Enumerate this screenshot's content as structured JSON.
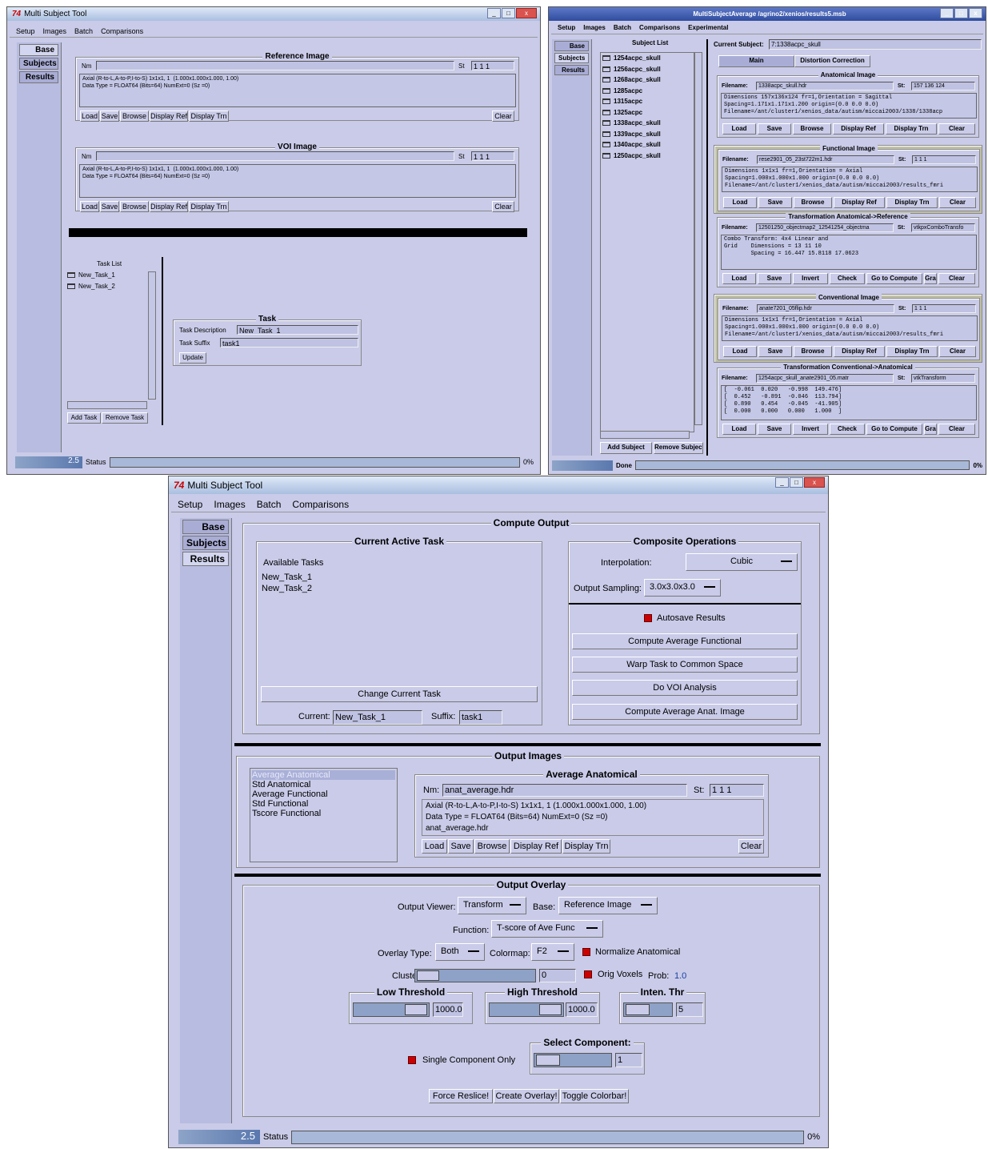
{
  "w1": {
    "title": "Multi Subject Tool",
    "menu": [
      "Setup",
      "Images",
      "Batch",
      "Comparisons"
    ],
    "tabs": [
      "Base",
      "Subjects",
      "Results"
    ],
    "ref": {
      "legend": "Reference Image",
      "nm_label": "Nm",
      "st_label": "St",
      "st_value": "1 1 1",
      "info1": "Axial (R-to-L,A-to-P,I-to-S) 1x1x1, 1  (1.000x1.000x1.000, 1.00)",
      "info2": "Data Type = FLOAT64 (Bits=64) NumExt=0 (Sz =0)"
    },
    "voi": {
      "legend": "VOI Image",
      "nm_label": "Nm",
      "st_label": "St",
      "st_value": "1 1 1",
      "info1": "Axial (R-to-L,A-to-P,I-to-S) 1x1x1, 1  (1.000x1.000x1.000, 1.00)",
      "info2": "Data Type = FLOAT64 (Bits=64) NumExt=0 (Sz =0)"
    },
    "imgbtns": [
      "Load",
      "Save",
      "Browse",
      "Display Ref",
      "Display Trn"
    ],
    "clear": "Clear",
    "tasklist": {
      "title": "Task List",
      "items": [
        "New_Task_1",
        "New_Task_2"
      ],
      "add": "Add Task",
      "remove": "Remove Task"
    },
    "task": {
      "legend": "Task",
      "desc_label": "Task Description",
      "desc": "New_Task_1",
      "suffix_label": "Task Suffix",
      "suffix": "task1",
      "update": "Update"
    },
    "status": {
      "zoom": "2.5",
      "label": "Status",
      "pct": "0%"
    }
  },
  "w2": {
    "title": "MultiSubjectAverage /agrino2/xenios/results5.msb",
    "menu": [
      "Setup",
      "Images",
      "Batch",
      "Comparisons",
      "Experimental"
    ],
    "tabs": [
      "Base",
      "Subjects",
      "Results"
    ],
    "subject_list": {
      "title": "Subject List",
      "items": [
        "1254acpc_skull",
        "1256acpc_skull",
        "1268acpc_skull",
        "1285acpc",
        "1315acpc",
        "1325acpc",
        "1338acpc_skull",
        "1339acpc_skull",
        "1340acpc_skull",
        "1250acpc_skull"
      ],
      "add": "Add Subject",
      "remove": "Remove Subject"
    },
    "current_label": "Current Subject:",
    "current_value": "7:1338acpc_skull",
    "subtabs": [
      "Main",
      "Distortion Correction"
    ],
    "anat": {
      "legend": "Anatomical Image",
      "fn_label": "Filename:",
      "fn": "1338acpc_skull.hdr",
      "st_label": "St:",
      "st": "157 136 124",
      "info": "Dimensions 157x136x124 fr=1,Orientation = Sagittal\nSpacing=1.171x1.171x1.200 origin=(0.0 0.0 0.0)\nFilename=/ant/cluster1/xenios_data/autism/miccai2003/1338/1338acp"
    },
    "func": {
      "legend": "Functional Image",
      "fn_label": "Filename:",
      "fn": "rese2901_05_23st722m1.hdr",
      "st_label": "St:",
      "st": "1 1 1",
      "info": "Dimensions 1x1x1 fr=1,Orientation = Axial\nSpacing=1.000x1.000x1.000 origin=(0.0 0.0 0.0)\nFilename=/ant/cluster1/xenios_data/autism/miccai2003/results_fmri"
    },
    "tar": {
      "legend": "Transformation Anatomical->Reference",
      "fn_label": "Filename:",
      "fn": "12501250_objectmap2_12541254_objectma",
      "st_label": "St:",
      "st": "vtkpxComboTransfo",
      "info": "Combo Transform: 4x4 Linear and\nGrid    Dimensions = 13 11 10\n        Spacing = 16.447 15.8118 17.0623"
    },
    "conv": {
      "legend": "Conventional Image",
      "fn_label": "Filename:",
      "fn": "anate7201_05flip.hdr",
      "st_label": "St:",
      "st": "1 1 1",
      "info": "Dimensions 1x1x1 fr=1,Orientation = Axial\nSpacing=1.000x1.000x1.000 origin=(0.0 0.0 0.0)\nFilename=/ant/cluster1/xenios_data/autism/miccai2003/results_fmri"
    },
    "tca": {
      "legend": "Transformation Conventional->Anatomical",
      "fn_label": "Filename:",
      "fn": "1254acpc_skull_anate2901_05.matr",
      "st_label": "St:",
      "st": "vtkTransform",
      "info": "[  -0.061  0.020   -0.998  149.476]\n[  0.452   -0.891  -0.046  113.794]\n[  0.890   0.454   -0.045  -41.905]\n[  0.000   0.000   0.000   1.000  ]"
    },
    "btns_img": [
      "Load",
      "Save",
      "Browse",
      "Display Ref",
      "Display Trn",
      "Clear"
    ],
    "btns_xf": [
      "Load",
      "Save",
      "Invert",
      "Check",
      "Go to Compute",
      "Gra",
      "Clear"
    ],
    "status": {
      "label": "Done",
      "pct": "0%"
    }
  },
  "w3": {
    "title": "Multi Subject Tool",
    "menu": [
      "Setup",
      "Images",
      "Batch",
      "Comparisons"
    ],
    "tabs": [
      "Base",
      "Subjects",
      "Results"
    ],
    "compute": {
      "legend": "Compute Output",
      "cat_legend": "Current Active Task",
      "available": "Available Tasks",
      "tasks": [
        "New_Task_1",
        "New_Task_2"
      ],
      "change": "Change Current Task",
      "current_label": "Current:",
      "current": "New_Task_1",
      "suffix_label": "Suffix:",
      "suffix": "task1",
      "co_legend": "Composite Operations",
      "interp_label": "Interpolation:",
      "interp": "Cubic",
      "samp_label": "Output Sampling:",
      "samp": "3.0x3.0x3.0",
      "autosave": "Autosave Results",
      "b1": "Compute Average Functional",
      "b2": "Warp Task to Common Space",
      "b3": "Do VOI Analysis",
      "b4": "Compute Average Anat. Image"
    },
    "outimg": {
      "legend": "Output Images",
      "list": [
        "Average Anatomical",
        "Std Anatomical",
        "Average Functional",
        "Std Functional",
        "Tscore Functional"
      ],
      "aa_legend": "Average Anatomical",
      "nm_label": "Nm:",
      "nm": "anat_average.hdr",
      "st_label": "St:",
      "st": "1 1 1",
      "info1": "Axial (R-to-L,A-to-P,I-to-S) 1x1x1, 1  (1.000x1.000x1.000, 1.00)",
      "info2": "Data Type = FLOAT64 (Bits=64) NumExt=0 (Sz =0)",
      "info3": "anat_average.hdr",
      "btns": [
        "Load",
        "Save",
        "Browse",
        "Display Ref",
        "Display Trn"
      ],
      "clear": "Clear"
    },
    "overlay": {
      "legend": "Output Overlay",
      "viewer_label": "Output Viewer:",
      "viewer": "Transform",
      "base_label": "Base:",
      "base": "Reference Image",
      "func_label": "Function:",
      "func": "T-score of Ave Func",
      "otype_label": "Overlay Type:",
      "otype": "Both",
      "cmap_label": "Colormap:",
      "cmap": "F2",
      "norm": "Normalize Anatomical",
      "clust_label": "Clustering:",
      "clust": "0",
      "orig": "Orig Voxels",
      "prob_label": "Prob:",
      "prob": "1.0",
      "low_legend": "Low Threshold",
      "low": "1000.0",
      "high_legend": "High Threshold",
      "high": "1000.0",
      "inten_legend": "Inten. Thr",
      "inten": "5",
      "single": "Single Component Only",
      "sel_legend": "Select Component:",
      "sel": "1",
      "force": "Force  Reslice!",
      "create": "Create Overlay!",
      "toggle": "Toggle Colorbar!"
    },
    "status": {
      "zoom": "2.5",
      "label": "Status",
      "pct": "0%"
    }
  }
}
